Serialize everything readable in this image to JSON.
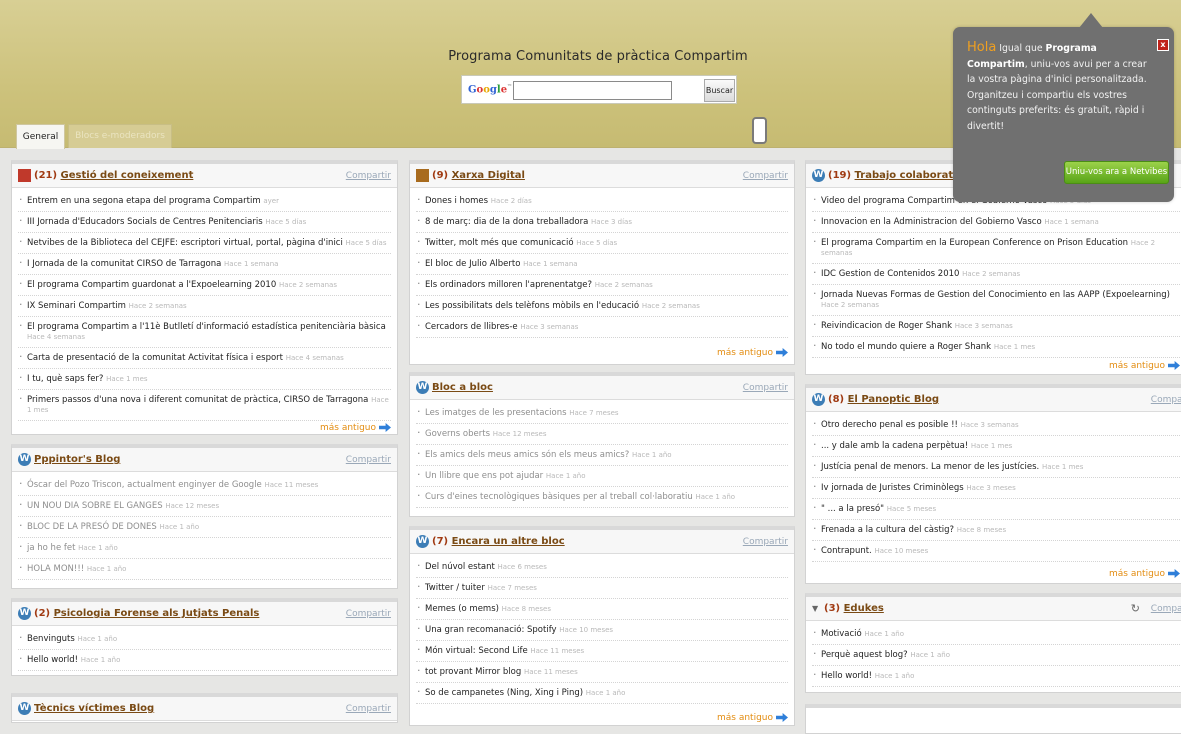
{
  "page_title": "Programa Comunitats de pràctica Compartim",
  "search": {
    "logo": [
      "G",
      "o",
      "o",
      "g",
      "l",
      "e"
    ],
    "logo_tm": "™",
    "button": "Buscar",
    "value": ""
  },
  "tabs": [
    "General",
    "Blocs e-moderadors"
  ],
  "share_label": "Compartir",
  "more_label": "más antiguo",
  "tooltip": {
    "hola": "Hola",
    "text1": " Igual que ",
    "bold": "Programa Compartim",
    "text2": ", uniu-vos avui per a crear la vostra pàgina d'inici personalitzada. Organitzeu i compartiu els vostres continguts preferits: és gratuït, ràpid i divertit!",
    "close": "x",
    "button": "Uniu-vos ara a Netvibes"
  },
  "widgets": {
    "gestio": {
      "count": "(21)",
      "title": "Gestió del coneixement",
      "items": [
        {
          "text": "Entrem en una segona etapa del programa Compartim",
          "time": "ayer"
        },
        {
          "text": "III Jornada d'Educadors Socials de Centres Penitenciaris",
          "time": "Hace 5 días"
        },
        {
          "text": "Netvibes de la Biblioteca del CEJFE: escriptori virtual, portal, pàgina d'inici",
          "time": "Hace 5 días"
        },
        {
          "text": "I Jornada de la comunitat CIRSO de Tarragona",
          "time": "Hace 1 semana"
        },
        {
          "text": "El programa Compartim guardonat a l'Expoelearning 2010",
          "time": "Hace 2 semanas"
        },
        {
          "text": "IX Seminari Compartim",
          "time": "Hace 2 semanas"
        },
        {
          "text": "El programa Compartim a l'11è Butlletí d'informació estadística penitenciària bàsica",
          "time": "Hace 4 semanas"
        },
        {
          "text": "Carta de presentació de la comunitat Activitat física i esport",
          "time": "Hace 4 semanas"
        },
        {
          "text": "I tu, què saps fer?",
          "time": "Hace 1 mes"
        },
        {
          "text": "Primers passos d'una nova i diferent comunitat de pràctica, CIRSO de Tarragona",
          "time": "Hace 1 mes"
        }
      ]
    },
    "pppintor": {
      "title": "Pppintor's Blog",
      "items": [
        {
          "text": "Óscar del Pozo Triscon, actualment enginyer de Google",
          "time": "Hace 11 meses"
        },
        {
          "text": "UN NOU DIA SOBRE EL GANGES",
          "time": "Hace 12 meses"
        },
        {
          "text": "BLOC DE LA PRESÓ DE DONES",
          "time": "Hace 1 año"
        },
        {
          "text": "ja ho he fet",
          "time": "Hace 1 año"
        },
        {
          "text": "HOLA MON!!!",
          "time": "Hace 1 año"
        }
      ]
    },
    "psico": {
      "count": "(2)",
      "title": "Psicologia Forense als Jutjats Penals",
      "items": [
        {
          "text": "Benvinguts",
          "time": "Hace 1 año"
        },
        {
          "text": "Hello world!",
          "time": "Hace 1 año"
        }
      ]
    },
    "tecnics": {
      "title": "Tècnics víctimes Blog"
    },
    "xarxa": {
      "count": "(9)",
      "title": "Xarxa Digital",
      "items": [
        {
          "text": "Dones i homes",
          "time": "Hace 2 días"
        },
        {
          "text": "8 de març: dia de la dona treballadora",
          "time": "Hace 3 días"
        },
        {
          "text": "Twitter, molt més que comunicació",
          "time": "Hace 5 días"
        },
        {
          "text": "El bloc de Julio Alberto",
          "time": "Hace 1 semana"
        },
        {
          "text": "Els ordinadors milloren l'aprenentatge?",
          "time": "Hace 2 semanas"
        },
        {
          "text": "Les possibilitats dels telèfons mòbils en l'educació",
          "time": "Hace 2 semanas"
        },
        {
          "text": "Cercadors de llibres-e",
          "time": "Hace 3 semanas"
        }
      ]
    },
    "blocabloc": {
      "title": "Bloc a bloc",
      "items": [
        {
          "text": "Les imatges de les presentacions",
          "time": "Hace 7 meses"
        },
        {
          "text": "Governs oberts",
          "time": "Hace 12 meses"
        },
        {
          "text": "Els amics dels meus amics són els meus amics?",
          "time": "Hace 1 año"
        },
        {
          "text": "Un llibre que ens pot ajudar",
          "time": "Hace 1 año"
        },
        {
          "text": "Curs d'eines tecnològiques bàsiques per al treball col·laboratiu",
          "time": "Hace 1 año"
        }
      ]
    },
    "encara": {
      "count": "(7)",
      "title": "Encara un altre bloc",
      "items": [
        {
          "text": "Del núvol estant",
          "time": "Hace 6 meses"
        },
        {
          "text": "Twitter / tuiter",
          "time": "Hace 7 meses"
        },
        {
          "text": "Memes (o mems)",
          "time": "Hace 8 meses"
        },
        {
          "text": "Una gran recomanació: Spotify",
          "time": "Hace 10 meses"
        },
        {
          "text": "Món virtual: Second Life",
          "time": "Hace 11 meses"
        },
        {
          "text": "tot provant Mirror blog",
          "time": "Hace 11 meses"
        },
        {
          "text": "So de campanetes (Ning, Xing i Ping)",
          "time": "Hace 1 año"
        }
      ]
    },
    "trabajo": {
      "count": "(19)",
      "title": "Trabajo colaborativo",
      "items": [
        {
          "text": "Video del programa Compartim en el Gobierno Vasco",
          "time": "Hace 5 días"
        },
        {
          "text": "Innovacion en la Administracion del Gobierno Vasco",
          "time": "Hace 1 semana"
        },
        {
          "text": "El programa Compartim en la European Conference on Prison Education",
          "time": "Hace 2 semanas"
        },
        {
          "text": "IDC Gestion de Contenidos 2010",
          "time": "Hace 2 semanas"
        },
        {
          "text": "Jornada Nuevas Formas de Gestion del Conocimiento en las AAPP (Expoelearning)",
          "time": "Hace 2 semanas"
        },
        {
          "text": "Reivindicacion de Roger Shank",
          "time": "Hace 3 semanas"
        },
        {
          "text": "No todo el mundo quiere a Roger Shank",
          "time": "Hace 1 mes"
        }
      ]
    },
    "panoptic": {
      "count": "(8)",
      "title": "El Panoptic Blog",
      "items": [
        {
          "text": "Otro derecho penal es posible !!",
          "time": "Hace 3 semanas"
        },
        {
          "text": "... y dale amb la cadena perpètua!",
          "time": "Hace 1 mes"
        },
        {
          "text": "Justícia penal de menors. La menor de les justícies.",
          "time": "Hace 1 mes"
        },
        {
          "text": "Iv jornada de Juristes Criminòlegs",
          "time": "Hace 3 meses"
        },
        {
          "text": "\" ... a la presó\"",
          "time": "Hace 5 meses"
        },
        {
          "text": "Frenada a la cultura del càstig?",
          "time": "Hace 8 meses"
        },
        {
          "text": "Contrapunt.",
          "time": "Hace 10 meses"
        }
      ]
    },
    "edukes": {
      "count": "(3)",
      "title": "Edukes",
      "items": [
        {
          "text": "Motivació",
          "time": "Hace 1 año"
        },
        {
          "text": "Perquè aquest blog?",
          "time": "Hace 1 año"
        },
        {
          "text": "Hello world!",
          "time": "Hace 1 año"
        }
      ]
    }
  }
}
